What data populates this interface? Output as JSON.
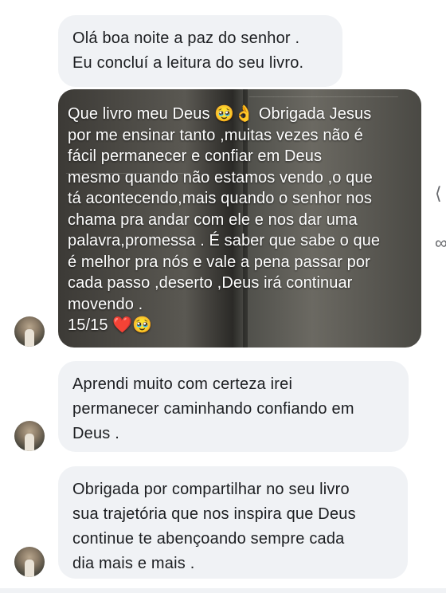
{
  "messages": [
    {
      "lines": [
        "Olá boa noite a paz do senhor .",
        "Eu concluí a leitura do seu livro."
      ]
    },
    {
      "caption_lines": [
        "Que livro meu Deus 🥹👌 Obrigada Jesus",
        "por me ensinar tanto ,muitas vezes não é",
        "fácil permanecer e confiar em Deus",
        "mesmo quando não estamos vendo ,o que",
        "tá acontecendo,mais quando o senhor nos",
        "chama pra andar com ele e nos dar uma",
        "palavra,promessa . É saber que sabe o que",
        "é melhor pra nós e vale a pena passar por",
        "cada passo ,deserto ,Deus irá continuar",
        "movendo ."
      ],
      "counter": "15/15 ❤️🥹"
    },
    {
      "lines": [
        "Aprendi muito com certeza irei",
        "permanecer caminhando confiando em",
        "Deus ."
      ]
    },
    {
      "lines": [
        "Obrigada por compartilhar no seu livro",
        "sua trajetória que nos inspira que Deus",
        "continue te abençoando sempre cada",
        "dia mais e mais ."
      ]
    }
  ],
  "icons": {
    "avatar": "user-avatar",
    "side_actions": [
      "share-icon",
      "link-icon"
    ]
  },
  "colors": {
    "bubble": "#f0f2f5",
    "text": "#1c1e21",
    "heart": "#e0245e"
  }
}
